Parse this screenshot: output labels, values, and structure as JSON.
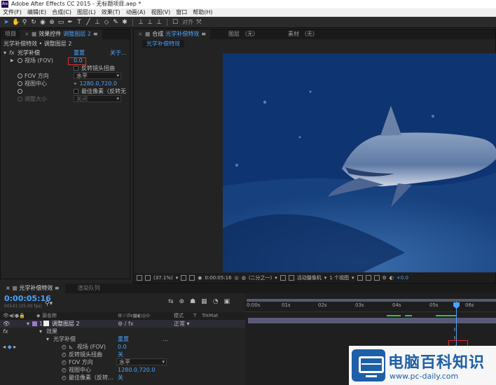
{
  "titlebar": {
    "app_icon": "Ae",
    "title": "Adobe After Effects CC 2015 - 无标题项目.aep *"
  },
  "menu": [
    "文件(F)",
    "编辑(E)",
    "合成(C)",
    "图层(L)",
    "效果(T)",
    "动画(A)",
    "视图(V)",
    "窗口",
    "帮助(H)"
  ],
  "toolbar": {
    "snap_label": "对齐"
  },
  "effect_controls": {
    "tabs": [
      {
        "label": "项目"
      },
      {
        "label": "效果控件",
        "target": "调整图层 2"
      }
    ],
    "breadcrumb": "光学补偿特效 • 调整图层 2",
    "effect": {
      "name": "光学补偿",
      "reset": "重置",
      "about": "关于..."
    },
    "properties": [
      {
        "label": "视场 (FOV)",
        "value": "0.0"
      },
      {
        "label": "",
        "value": "反转镜头扭曲"
      },
      {
        "label": "FOV 方向",
        "value": "水平"
      },
      {
        "label": "视图中心",
        "value": "1280.0,720.0"
      },
      {
        "label": "",
        "value": "最佳像素（反转无"
      },
      {
        "label": "调整大小",
        "value": "关闭"
      }
    ]
  },
  "comp": {
    "tabs": [
      {
        "label": "合成",
        "target": "光学补偿特效"
      },
      {
        "label": "图层",
        "target": "（无）"
      },
      {
        "label": "素材",
        "target": "（无）"
      }
    ],
    "subtab": "光学补偿特效",
    "footer": {
      "zoom": "(37.1%)",
      "timecode": "0:00:05:16",
      "resolution": "(二分之一)",
      "camera": "活动摄像机",
      "views": "1 个视图",
      "exposure": "+0.0"
    }
  },
  "timeline": {
    "tabs": [
      "光学补偿特效",
      "渲染队列"
    ],
    "timecode": "0:00:05:16",
    "fps": "00141 (25.00 fps)",
    "headers": {
      "source": "源名称",
      "mode": "模式",
      "t": "T",
      "trkmat": "TrkMat"
    },
    "ruler": [
      "0:00s",
      "01s",
      "02s",
      "03s",
      "04s",
      "05s",
      "06s"
    ],
    "layer": {
      "index": "1",
      "name": "调整图层 2",
      "mode": "正常"
    },
    "rows": [
      {
        "label": "效果",
        "value": ""
      },
      {
        "label": "光学补偿",
        "value": "重置"
      },
      {
        "label": "视场 (FOV)",
        "value": "0.0"
      },
      {
        "label": "反转镜头扭曲",
        "value": "关"
      },
      {
        "label": "FOV 方向",
        "value": "水平"
      },
      {
        "label": "视图中心",
        "value": "1280.0,720.0"
      },
      {
        "label": "最佳像素（反转...",
        "value": "关"
      }
    ]
  },
  "watermark": {
    "name": "电脑百科知识",
    "url": "www.pc-daily.com"
  }
}
